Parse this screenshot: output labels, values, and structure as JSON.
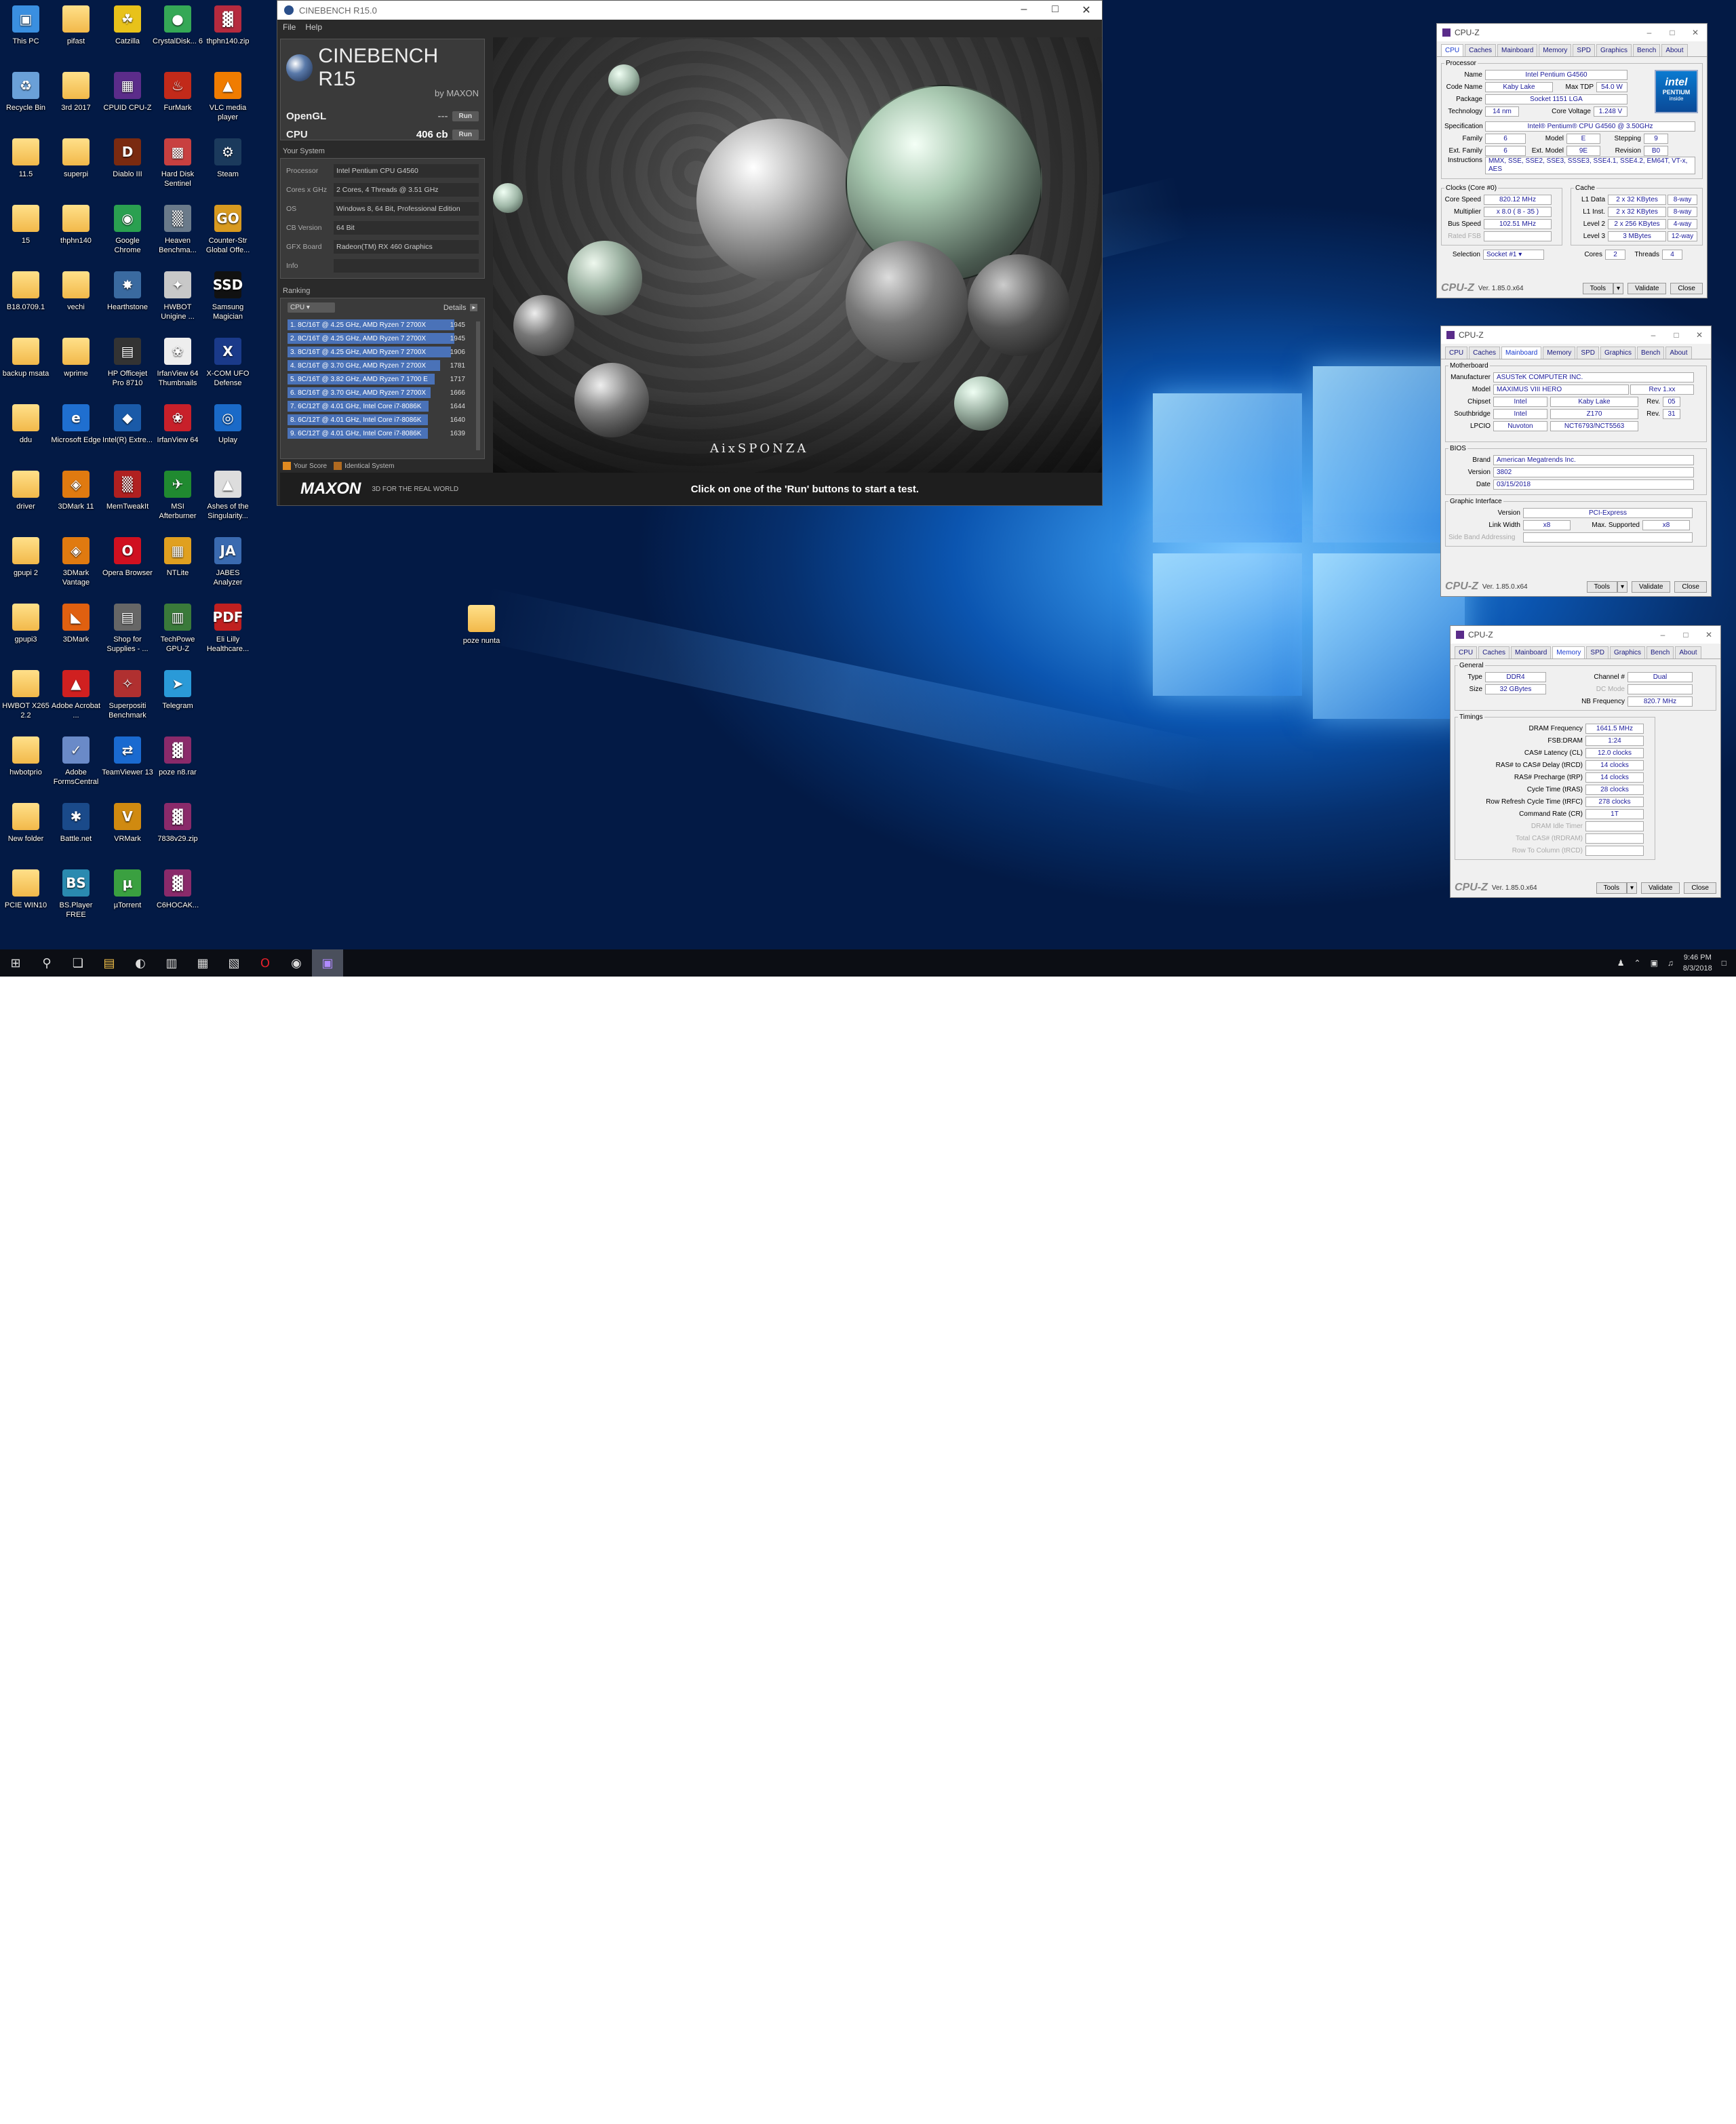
{
  "desktop": {
    "icons": [
      {
        "label": "This PC",
        "glyph": "▣",
        "color": "#3a8fe0"
      },
      {
        "label": "pifast",
        "glyph": "",
        "color": "folder"
      },
      {
        "label": "Catzilla",
        "glyph": "☘",
        "color": "#e8c21a"
      },
      {
        "label": "CrystalDisk... 6",
        "glyph": "●",
        "color": "#35a856"
      },
      {
        "label": "thphn140.zip",
        "glyph": "▓",
        "color": "#b52a3e"
      },
      {
        "label": "Recycle Bin",
        "glyph": "♻",
        "color": "#6aa0d8"
      },
      {
        "label": "3rd 2017",
        "glyph": "",
        "color": "folder"
      },
      {
        "label": "CPUID CPU-Z",
        "glyph": "▦",
        "color": "#5b2c8a"
      },
      {
        "label": "FurMark",
        "glyph": "♨",
        "color": "#c22a1a"
      },
      {
        "label": "VLC media player",
        "glyph": "▲",
        "color": "#f07c00"
      },
      {
        "label": "11.5",
        "glyph": "",
        "color": "folder"
      },
      {
        "label": "superpi",
        "glyph": "",
        "color": "folder"
      },
      {
        "label": "Diablo III",
        "glyph": "D",
        "color": "#7a2a10"
      },
      {
        "label": "Hard Disk Sentinel",
        "glyph": "▩",
        "color": "#c84040"
      },
      {
        "label": "Steam",
        "glyph": "⚙",
        "color": "#1b3a5c"
      },
      {
        "label": "15",
        "glyph": "",
        "color": "folder"
      },
      {
        "label": "thphn140",
        "glyph": "",
        "color": "folder"
      },
      {
        "label": "Google Chrome",
        "glyph": "◉",
        "color": "#2aa050"
      },
      {
        "label": "Heaven Benchma...",
        "glyph": "▒",
        "color": "#6a7a8a"
      },
      {
        "label": "Counter-Str Global Offe...",
        "glyph": "GO",
        "color": "#d89a20"
      },
      {
        "label": "B18.0709.1",
        "glyph": "",
        "color": "folder"
      },
      {
        "label": "vechi",
        "glyph": "",
        "color": "folder"
      },
      {
        "label": "Hearthstone",
        "glyph": "✸",
        "color": "#3a6aa0"
      },
      {
        "label": "HWBOT Unigine ...",
        "glyph": "✦",
        "color": "#c8c8c8"
      },
      {
        "label": "Samsung Magician",
        "glyph": "SSD",
        "color": "#111111"
      },
      {
        "label": "backup msata",
        "glyph": "",
        "color": "folder"
      },
      {
        "label": "wprime",
        "glyph": "",
        "color": "folder"
      },
      {
        "label": "HP Officejet Pro 8710",
        "glyph": "▤",
        "color": "#333333"
      },
      {
        "label": "IrfanView 64 Thumbnails",
        "glyph": "❀",
        "color": "#eeeeee"
      },
      {
        "label": "X-COM UFO Defense",
        "glyph": "X",
        "color": "#1a3a8a"
      },
      {
        "label": "ddu",
        "glyph": "",
        "color": "folder"
      },
      {
        "label": "Microsoft Edge",
        "glyph": "e",
        "color": "#1f6fd0"
      },
      {
        "label": "Intel(R) Extre...",
        "glyph": "◆",
        "color": "#1a5aa8"
      },
      {
        "label": "IrfanView 64",
        "glyph": "❀",
        "color": "#c8202a"
      },
      {
        "label": "Uplay",
        "glyph": "◎",
        "color": "#1a6ac8"
      },
      {
        "label": "driver",
        "glyph": "",
        "color": "folder"
      },
      {
        "label": "3DMark 11",
        "glyph": "◈",
        "color": "#e07a10"
      },
      {
        "label": "MemTweakIt",
        "glyph": "▒",
        "color": "#b02020"
      },
      {
        "label": "MSI Afterburner",
        "glyph": "✈",
        "color": "#208a30"
      },
      {
        "label": "Ashes of the Singularity...",
        "glyph": "▲",
        "color": "#dddddd"
      },
      {
        "label": "gpupi 2",
        "glyph": "",
        "color": "folder"
      },
      {
        "label": "3DMark Vantage",
        "glyph": "◈",
        "color": "#e07a10"
      },
      {
        "label": "Opera Browser",
        "glyph": "O",
        "color": "#d01020"
      },
      {
        "label": "NTLite",
        "glyph": "▦",
        "color": "#e0a020"
      },
      {
        "label": "JABES Analyzer",
        "glyph": "JA",
        "color": "#3a6ab0"
      },
      {
        "label": "gpupi3",
        "glyph": "",
        "color": "folder"
      },
      {
        "label": "3DMark",
        "glyph": "◣",
        "color": "#e06010"
      },
      {
        "label": "Shop for Supplies - ...",
        "glyph": "▤",
        "color": "#666666"
      },
      {
        "label": "TechPowe GPU-Z",
        "glyph": "▥",
        "color": "#3a7a3a"
      },
      {
        "label": "Eli Lilly Healthcare...",
        "glyph": "PDF",
        "color": "#c02020"
      },
      {
        "label": "HWBOT X265 2.2",
        "glyph": "",
        "color": "folder"
      },
      {
        "label": "Adobe Acrobat ...",
        "glyph": "▲",
        "color": "#d02020"
      },
      {
        "label": "Superpositi Benchmark",
        "glyph": "✧",
        "color": "#b03030"
      },
      {
        "label": "Telegram",
        "glyph": "➤",
        "color": "#2a9ad8"
      },
      {
        "label": "hwbotprio",
        "glyph": "",
        "color": "folder"
      },
      {
        "label": "Adobe FormsCentral",
        "glyph": "✓",
        "color": "#6a8ac8"
      },
      {
        "label": "TeamViewer 13",
        "glyph": "⇄",
        "color": "#1a6ad0"
      },
      {
        "label": "poze n8.rar",
        "glyph": "▓",
        "color": "#8a2a6a"
      },
      {
        "label": "New folder",
        "glyph": "",
        "color": "folder"
      },
      {
        "label": "Battle.net",
        "glyph": "✱",
        "color": "#1a4a8a"
      },
      {
        "label": "VRMark",
        "glyph": "V",
        "color": "#d08a10"
      },
      {
        "label": "7838v29.zip",
        "glyph": "▓",
        "color": "#8a2a6a"
      },
      {
        "label": "PCIE WIN10",
        "glyph": "",
        "color": "folder"
      },
      {
        "label": "BS.Player FREE",
        "glyph": "BS",
        "color": "#2a8ab0"
      },
      {
        "label": "µTorrent",
        "glyph": "µ",
        "color": "#3aa040"
      },
      {
        "label": "C6HOCAK...",
        "glyph": "▓",
        "color": "#8a2a6a"
      }
    ],
    "extra_folder": {
      "label": "poze nunta"
    }
  },
  "cinebench": {
    "title": "CINEBENCH R15.0",
    "menu": [
      "File",
      "Help"
    ],
    "brand": "CINEBENCH R15",
    "byline": "by MAXON",
    "opengl_label": "OpenGL",
    "opengl_value": "---",
    "run_label": "Run",
    "cpu_label": "CPU",
    "cpu_value": "406 cb",
    "your_system_label": "Your System",
    "system": [
      {
        "k": "Processor",
        "v": "Intel Pentium CPU G4560"
      },
      {
        "k": "Cores x GHz",
        "v": "2 Cores, 4 Threads @ 3.51 GHz"
      },
      {
        "k": "OS",
        "v": "Windows 8, 64 Bit, Professional Edition"
      },
      {
        "k": "CB Version",
        "v": "64 Bit"
      },
      {
        "k": "GFX Board",
        "v": "Radeon(TM) RX 460 Graphics"
      },
      {
        "k": "Info",
        "v": ""
      }
    ],
    "ranking_label": "Ranking",
    "ranking_select": "CPU",
    "details_label": "Details",
    "ranking": [
      {
        "t": "1. 8C/16T @ 4.25 GHz, AMD Ryzen 7 2700X",
        "s": "1945",
        "f": 1.0
      },
      {
        "t": "2. 8C/16T @ 4.25 GHz, AMD Ryzen 7 2700X",
        "s": "1945",
        "f": 1.0
      },
      {
        "t": "3. 8C/16T @ 4.25 GHz, AMD Ryzen 7 2700X",
        "s": "1906",
        "f": 0.98
      },
      {
        "t": "4. 8C/16T @ 3.70 GHz, AMD Ryzen 7 2700X",
        "s": "1781",
        "f": 0.915
      },
      {
        "t": "5. 8C/16T @ 3.82 GHz, AMD Ryzen 7 1700 E",
        "s": "1717",
        "f": 0.883
      },
      {
        "t": "6. 8C/16T @ 3.70 GHz, AMD Ryzen 7 2700X",
        "s": "1666",
        "f": 0.856
      },
      {
        "t": "7. 6C/12T @ 4.01 GHz, Intel Core i7-8086K",
        "s": "1644",
        "f": 0.845
      },
      {
        "t": "8. 6C/12T @ 4.01 GHz, Intel Core i7-8086K",
        "s": "1640",
        "f": 0.843
      },
      {
        "t": "9. 6C/12T @ 4.01 GHz, Intel Core i7-8086K",
        "s": "1639",
        "f": 0.842
      }
    ],
    "legend_your": "Your Score",
    "legend_ident": "Identical System",
    "maxon": "MAXON",
    "tagline": "3D FOR THE REAL WORLD",
    "hint": "Click on one of the 'Run' buttons to start a test.",
    "render_credit": "AixSPONZA"
  },
  "cpuz_tabs": [
    "CPU",
    "Caches",
    "Mainboard",
    "Memory",
    "SPD",
    "Graphics",
    "Bench",
    "About"
  ],
  "cpuz_title": "CPU-Z",
  "cpuz_footer": {
    "logo": "CPU-Z",
    "ver": "Ver. 1.85.0.x64",
    "tools": "Tools",
    "validate": "Validate",
    "close": "Close"
  },
  "cpuz_cpu": {
    "processor": "Processor",
    "name_l": "Name",
    "name": "Intel Pentium G4560",
    "code_l": "Code Name",
    "code": "Kaby Lake",
    "tdp_l": "Max TDP",
    "tdp": "54.0 W",
    "pkg_l": "Package",
    "pkg": "Socket 1151 LGA",
    "tech_l": "Technology",
    "tech": "14 nm",
    "volt_l": "Core Voltage",
    "volt": "1.248 V",
    "spec_l": "Specification",
    "spec": "Intel® Pentium® CPU G4560 @ 3.50GHz",
    "fam_l": "Family",
    "fam": "6",
    "model_l": "Model",
    "model": "E",
    "step_l": "Stepping",
    "step": "9",
    "efam_l": "Ext. Family",
    "efam": "6",
    "emod_l": "Ext. Model",
    "emod": "9E",
    "rev_l": "Revision",
    "rev": "B0",
    "inst_l": "Instructions",
    "inst": "MMX, SSE, SSE2, SSE3, SSSE3, SSE4.1, SSE4.2, EM64T, VT-x, AES",
    "clocks": "Clocks (Core #0)",
    "cache": "Cache",
    "cs_l": "Core Speed",
    "cs": "820.12 MHz",
    "l1d_l": "L1 Data",
    "l1d": "2 x 32 KBytes",
    "l1d_w": "8-way",
    "mul_l": "Multiplier",
    "mul": "x 8.0 ( 8 - 35 )",
    "l1i_l": "L1 Inst.",
    "l1i": "2 x 32 KBytes",
    "l1i_w": "8-way",
    "bus_l": "Bus Speed",
    "bus": "102.51 MHz",
    "l2_l": "Level 2",
    "l2": "2 x 256 KBytes",
    "l2_w": "4-way",
    "fsb_l": "Rated FSB",
    "l3_l": "Level 3",
    "l3": "3 MBytes",
    "l3_w": "12-way",
    "sel_l": "Selection",
    "sel": "Socket #1",
    "cores_l": "Cores",
    "cores": "2",
    "thr_l": "Threads",
    "thr": "4",
    "intel_badge": "intel",
    "intel_sub": "PENTIUM",
    "intel_inside": "inside"
  },
  "cpuz_mb": {
    "mb": "Motherboard",
    "man_l": "Manufacturer",
    "man": "ASUSTeK COMPUTER INC.",
    "mod_l": "Model",
    "mod": "MAXIMUS VIII HERO",
    "mod_rev": "Rev 1.xx",
    "chip_l": "Chipset",
    "chip_v": "Intel",
    "chip_n": "Kaby Lake",
    "chip_rl": "Rev.",
    "chip_r": "05",
    "sb_l": "Southbridge",
    "sb_v": "Intel",
    "sb_n": "Z170",
    "sb_rl": "Rev.",
    "sb_r": "31",
    "lpc_l": "LPCIO",
    "lpc_v": "Nuvoton",
    "lpc_n": "NCT6793/NCT5563",
    "bios": "BIOS",
    "brand_l": "Brand",
    "brand": "American Megatrends Inc.",
    "ver_l": "Version",
    "ver": "3802",
    "date_l": "Date",
    "date": "03/15/2018",
    "gi": "Graphic Interface",
    "giv_l": "Version",
    "giv": "PCI-Express",
    "lw_l": "Link Width",
    "lw": "x8",
    "ms_l": "Max. Supported",
    "ms": "x8",
    "sba_l": "Side Band Addressing"
  },
  "cpuz_mem": {
    "gen": "General",
    "type_l": "Type",
    "type": "DDR4",
    "ch_l": "Channel #",
    "ch": "Dual",
    "size_l": "Size",
    "size": "32 GBytes",
    "dc_l": "DC Mode",
    "nb_l": "NB Frequency",
    "nb": "820.7 MHz",
    "tim": "Timings",
    "rows": [
      {
        "l": "DRAM Frequency",
        "v": "1641.5 MHz"
      },
      {
        "l": "FSB:DRAM",
        "v": "1:24"
      },
      {
        "l": "CAS# Latency (CL)",
        "v": "12.0 clocks"
      },
      {
        "l": "RAS# to CAS# Delay (tRCD)",
        "v": "14 clocks"
      },
      {
        "l": "RAS# Precharge (tRP)",
        "v": "14 clocks"
      },
      {
        "l": "Cycle Time (tRAS)",
        "v": "28 clocks"
      },
      {
        "l": "Row Refresh Cycle Time (tRFC)",
        "v": "278 clocks"
      },
      {
        "l": "Command Rate (CR)",
        "v": "1T"
      },
      {
        "l": "DRAM Idle Timer",
        "v": ""
      },
      {
        "l": "Total CAS# (tRDRAM)",
        "v": ""
      },
      {
        "l": "Row To Column (tRCD)",
        "v": ""
      }
    ]
  },
  "taskbar": {
    "time": "9:46 PM",
    "date": "8/3/2018"
  }
}
